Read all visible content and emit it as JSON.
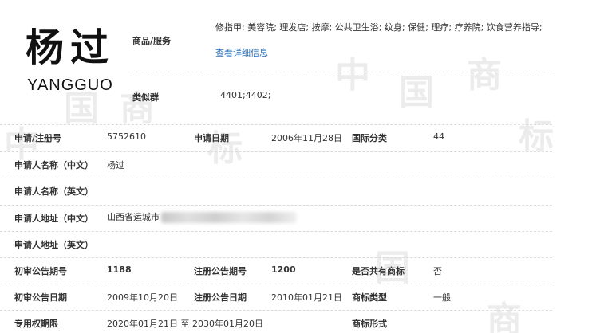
{
  "logo": {
    "chinese": "杨过",
    "english": "YANGGUO"
  },
  "watermark": {
    "chars": [
      "中",
      "国",
      "商",
      "标",
      "中",
      "国",
      "商",
      "标",
      "国",
      "商"
    ]
  },
  "goods": {
    "label": "商品/服务",
    "text": "修指甲; 美容院; 理发店; 按摩; 公共卫生浴; 纹身; 保健; 理疗; 疗养院; 饮食营养指导;",
    "link": "查看详细信息"
  },
  "similar": {
    "label": "类似群",
    "value": "4401;4402;"
  },
  "fields": {
    "reg_no_label": "申请/注册号",
    "reg_no": "5752610",
    "app_date_label": "申请日期",
    "app_date": "2006年11月28日",
    "intl_class_label": "国际分类",
    "intl_class": "44",
    "applicant_cn_label": "申请人名称（中文）",
    "applicant_cn": "杨过",
    "applicant_en_label": "申请人名称（英文）",
    "applicant_en": "",
    "address_cn_label": "申请人地址（中文）",
    "address_cn": "山西省运城市",
    "address_en_label": "申请人地址（英文）",
    "address_en": "",
    "prelim_no_label": "初审公告期号",
    "prelim_no": "1188",
    "reg_pub_no_label": "注册公告期号",
    "reg_pub_no": "1200",
    "shared_label": "是否共有商标",
    "shared": "否",
    "prelim_date_label": "初审公告日期",
    "prelim_date": "2009年10月20日",
    "reg_pub_date_label": "注册公告日期",
    "reg_pub_date": "2010年01月21日",
    "mark_type_label": "商标类型",
    "mark_type": "一般",
    "term_label": "专用权期限",
    "term": "2020年01月21日 至 2030年01月20日",
    "mark_form_label": "商标形式",
    "mark_form": ""
  }
}
